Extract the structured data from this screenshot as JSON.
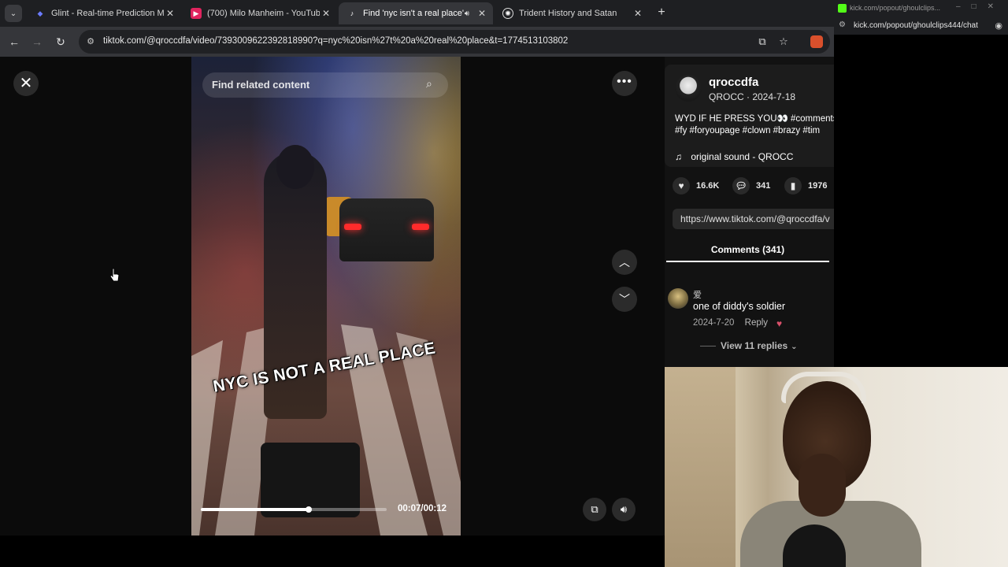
{
  "browser": {
    "tabs": [
      {
        "title": "Glint - Real-time Prediction Ma",
        "favicon": "glint-icon",
        "active": false
      },
      {
        "title": "(700) Milo Manheim - YouTube",
        "favicon": "youtube-icon",
        "active": false
      },
      {
        "title": "Find 'nyc isn't a real place' ",
        "favicon": "tiktok-icon",
        "active": true
      },
      {
        "title": "Trident History and Satan",
        "favicon": "openai-icon",
        "active": false
      }
    ],
    "url": "tiktok.com/@qroccdfa/video/7393009622392818990?q=nyc%20isn%27t%20a%20real%20place&t=1774513103802"
  },
  "video": {
    "search_placeholder": "Find related content",
    "caption": "NYC IS NOT A REAL PLACE",
    "time": "00:07/00:12",
    "progress_fraction": 0.58
  },
  "post": {
    "username": "qroccdfa",
    "subline": "QROCC · 2024-7-18",
    "description_line1": "WYD IF HE PRESS YOU👀 #comments",
    "description_line2": "#fy #foryoupage #clown #brazy #tim",
    "music": "original sound - QROCC",
    "likes": "16.6K",
    "comments": "341",
    "saves": "1976",
    "share_link": "https://www.tiktok.com/@qroccdfa/v"
  },
  "comments_panel": {
    "tab_label": "Comments (341)",
    "items": [
      {
        "user": "爱",
        "text": "one of diddy's soldier",
        "date": "2024-7-20",
        "reply_label": "Reply",
        "view_replies": "View 11 replies"
      }
    ]
  },
  "popout": {
    "title_bar": "kick.com/popout/ghoulclips...",
    "url": "kick.com/popout/ghoulclips444/chat"
  },
  "colors": {
    "accent_like": "#fe2c55",
    "kick_green": "#53fc18"
  }
}
